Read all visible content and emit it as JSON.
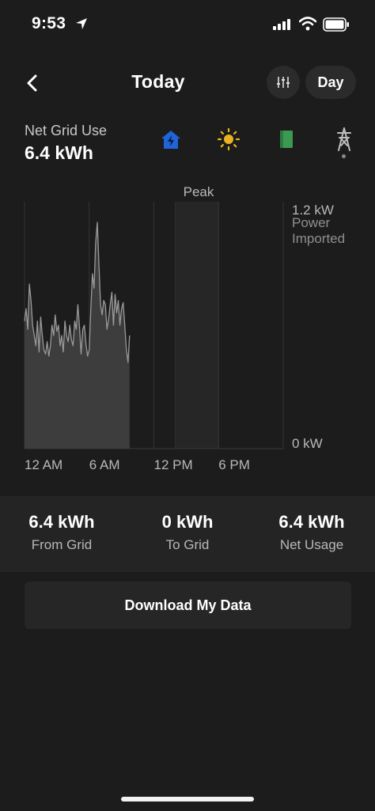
{
  "status_bar": {
    "time": "9:53"
  },
  "header": {
    "title": "Today",
    "period_label": "Day"
  },
  "metric": {
    "label": "Net Grid Use",
    "value": "6.4 kWh"
  },
  "colors": {
    "background": "#1c1c1c",
    "home_icon": "#1f64d8",
    "solar_icon": "#e8b321",
    "battery_icon": "#3a9a52",
    "grid_icon": "#bdbdbd"
  },
  "source_icons": [
    "home-icon",
    "solar-icon",
    "battery-icon",
    "grid-icon"
  ],
  "chart_data": {
    "type": "area",
    "peak_label": "Peak",
    "y_top_label": "1.2 kW",
    "y_bottom_label": "0 kW",
    "y_legend_line1": "Power",
    "y_legend_line2": "Imported",
    "x_tick_labels": [
      "12 AM",
      "6 AM",
      "12 PM",
      "6 PM"
    ],
    "x_range_hours": [
      0,
      24
    ],
    "ylim_kw": [
      0,
      1.2
    ],
    "peak_window_hours": [
      14,
      18
    ],
    "grid": true,
    "x_hours": [
      0,
      0.15,
      0.3,
      0.45,
      0.6,
      0.75,
      0.9,
      1.05,
      1.2,
      1.35,
      1.5,
      1.65,
      1.8,
      1.95,
      2.1,
      2.25,
      2.4,
      2.55,
      2.7,
      2.85,
      3.0,
      3.15,
      3.3,
      3.45,
      3.6,
      3.75,
      3.9,
      4.05,
      4.2,
      4.35,
      4.5,
      4.65,
      4.8,
      4.95,
      5.1,
      5.25,
      5.4,
      5.55,
      5.7,
      5.85,
      6.0,
      6.15,
      6.3,
      6.45,
      6.6,
      6.75,
      6.9,
      7.05,
      7.2,
      7.35,
      7.5,
      7.65,
      7.8,
      7.95,
      8.1,
      8.25,
      8.4,
      8.55,
      8.7,
      8.85,
      9.0,
      9.15,
      9.3,
      9.45,
      9.6,
      9.75
    ],
    "values_kw": [
      0.62,
      0.68,
      0.58,
      0.8,
      0.72,
      0.6,
      0.55,
      0.5,
      0.62,
      0.47,
      0.64,
      0.55,
      0.48,
      0.46,
      0.52,
      0.45,
      0.5,
      0.6,
      0.55,
      0.65,
      0.57,
      0.6,
      0.5,
      0.55,
      0.47,
      0.62,
      0.55,
      0.52,
      0.6,
      0.53,
      0.5,
      0.62,
      0.58,
      0.7,
      0.59,
      0.46,
      0.58,
      0.6,
      0.51,
      0.45,
      0.48,
      0.68,
      0.85,
      0.78,
      1.0,
      1.1,
      0.9,
      0.7,
      0.65,
      0.72,
      0.7,
      0.58,
      0.63,
      0.7,
      0.76,
      0.6,
      0.75,
      0.66,
      0.72,
      0.6,
      0.68,
      0.71,
      0.6,
      0.48,
      0.42,
      0.55
    ]
  },
  "summary": {
    "from_grid": {
      "value": "6.4 kWh",
      "label": "From Grid"
    },
    "to_grid": {
      "value": "0 kWh",
      "label": "To Grid"
    },
    "net_usage": {
      "value": "6.4 kWh",
      "label": "Net Usage"
    }
  },
  "download_label": "Download My Data"
}
